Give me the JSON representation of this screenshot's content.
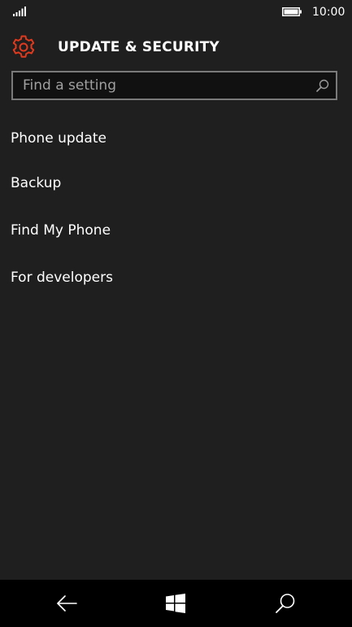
{
  "status_bar": {
    "time": "10:00",
    "icons": [
      "signal-strength-icon",
      "battery-icon"
    ]
  },
  "header": {
    "title": "UPDATE & SECURITY",
    "icon": "gear-icon",
    "accent_color": "#e03a1e"
  },
  "search": {
    "placeholder": "Find a setting",
    "value": "",
    "icon": "search-icon"
  },
  "menu": {
    "items": [
      {
        "label": "Phone update"
      },
      {
        "label": "Backup"
      },
      {
        "label": "Find My Phone"
      },
      {
        "label": "For developers"
      }
    ]
  },
  "nav_bar": {
    "buttons": [
      "back-arrow-icon",
      "windows-logo-icon",
      "search-icon"
    ]
  },
  "colors": {
    "background": "#1f1f1f",
    "nav_background": "#000000",
    "text": "#ffffff",
    "field_border": "#7a7a7a"
  }
}
